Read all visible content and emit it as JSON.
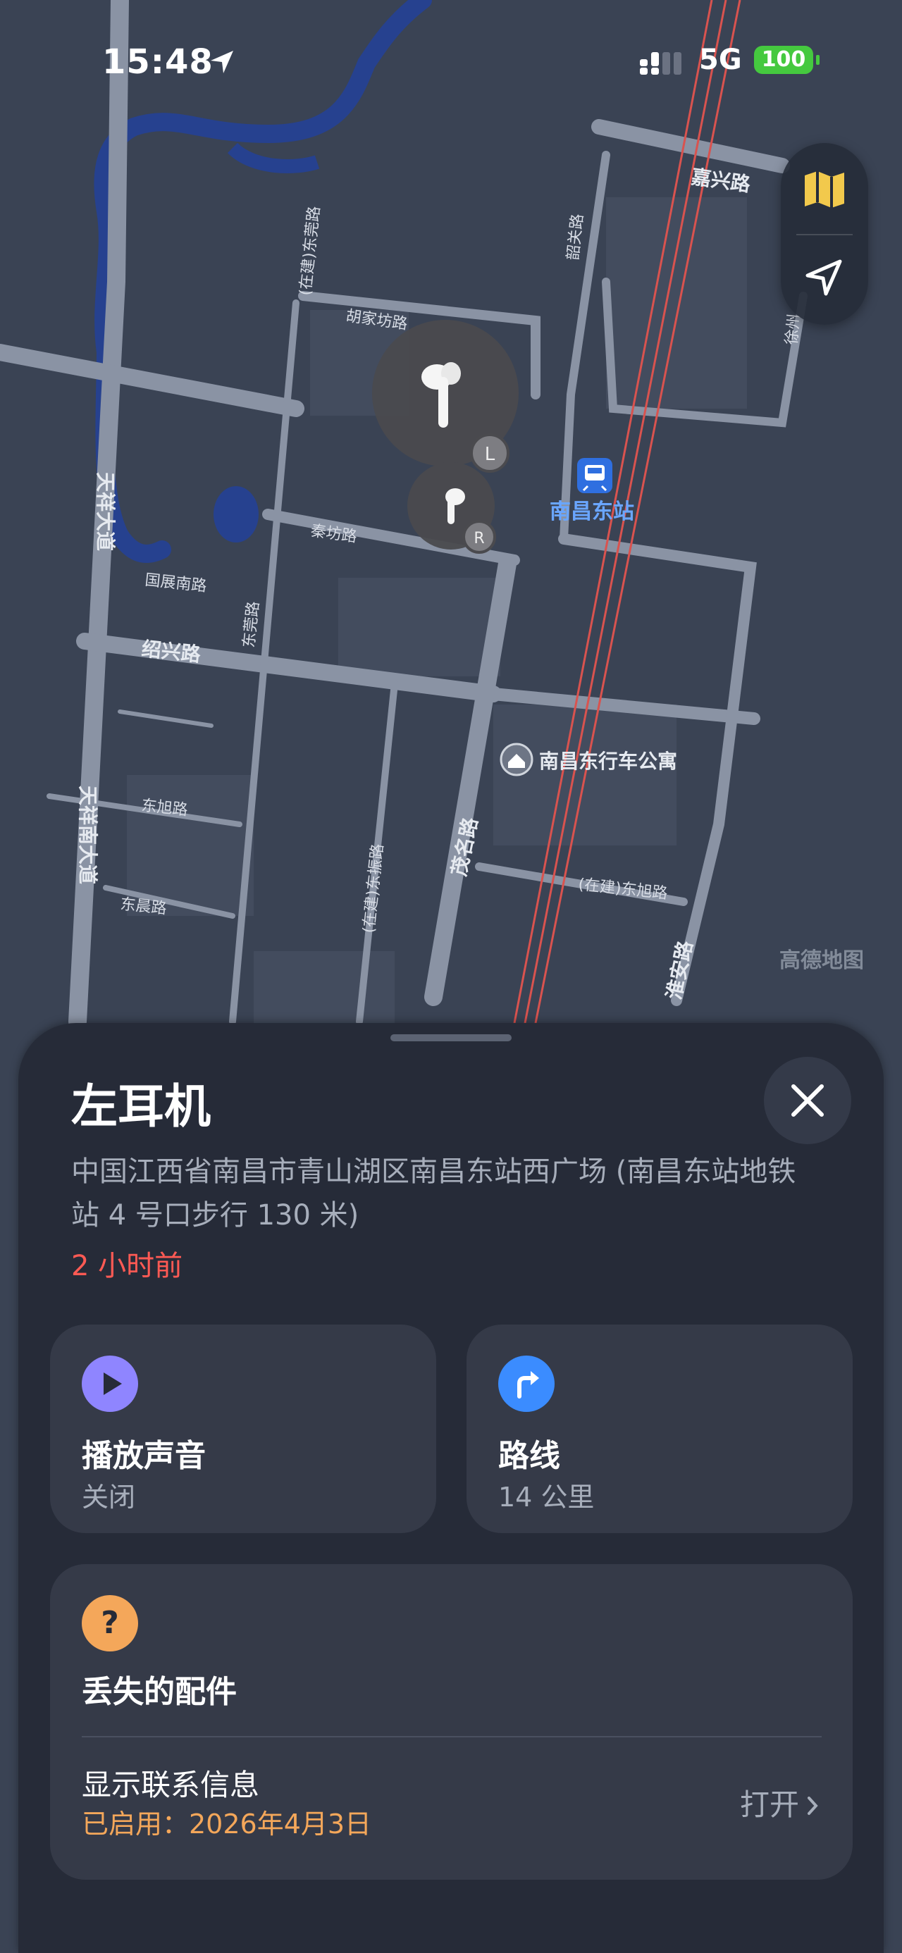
{
  "status_bar": {
    "time": "15:48",
    "network": "5G",
    "battery": "100"
  },
  "map": {
    "roads": {
      "jiaxing": "嘉兴路",
      "hujiafang": "胡家坊路",
      "qinfang": "秦坊路",
      "guozhannan": "国展南路",
      "shaoxing": "绍兴路",
      "tianxiang": "天祥大道",
      "tianxiang_south": "天祥南大道",
      "dongxu": "东旭路",
      "dongchen": "东晨路",
      "dongwan_building": "(在建)东莞路",
      "dongwan": "东莞路",
      "dongzhen_building": "(在建)东振路",
      "maoming": "茂名路",
      "huaian": "淮安路",
      "dongxu_building": "(在建)东旭路",
      "shaoxian": "韶关路",
      "xuzhou": "徐州"
    },
    "station": "南昌东站",
    "apartment": "南昌东行车公寓",
    "watermark": "高德地图",
    "earbud_left_badge": "L",
    "earbud_right_badge": "R"
  },
  "sheet": {
    "title": "左耳机",
    "address": "中国江西省南昌市青山湖区南昌东站西广场 (南昌东站地铁站 4 号口步行 130 米)",
    "time_ago": "2 小时前",
    "sound": {
      "label": "播放声音",
      "sub": "关闭"
    },
    "route": {
      "label": "路线",
      "sub": "14 公里"
    },
    "lost": {
      "label": "丢失的配件",
      "contact_label": "显示联系信息",
      "contact_sub": "已启用：2026年4月3日",
      "open": "打开"
    }
  },
  "icons": {
    "location_arrow": "location-arrow-icon",
    "map_toggle": "map-icon",
    "locate": "locate-icon",
    "close": "close-icon",
    "play": "play-icon",
    "route": "route-arrow-icon",
    "question": "question-icon",
    "chevron": "chevron-right-icon"
  },
  "colors": {
    "map_bg": "#3a4354",
    "road": "#8a93a4",
    "river": "#26418f",
    "rail": "#d9534f",
    "sheet_bg": "#262b38",
    "card_bg": "#353a48",
    "time_ago": "#ff5a54",
    "accent_orange": "#f4a75a",
    "battery": "#45c93f"
  }
}
